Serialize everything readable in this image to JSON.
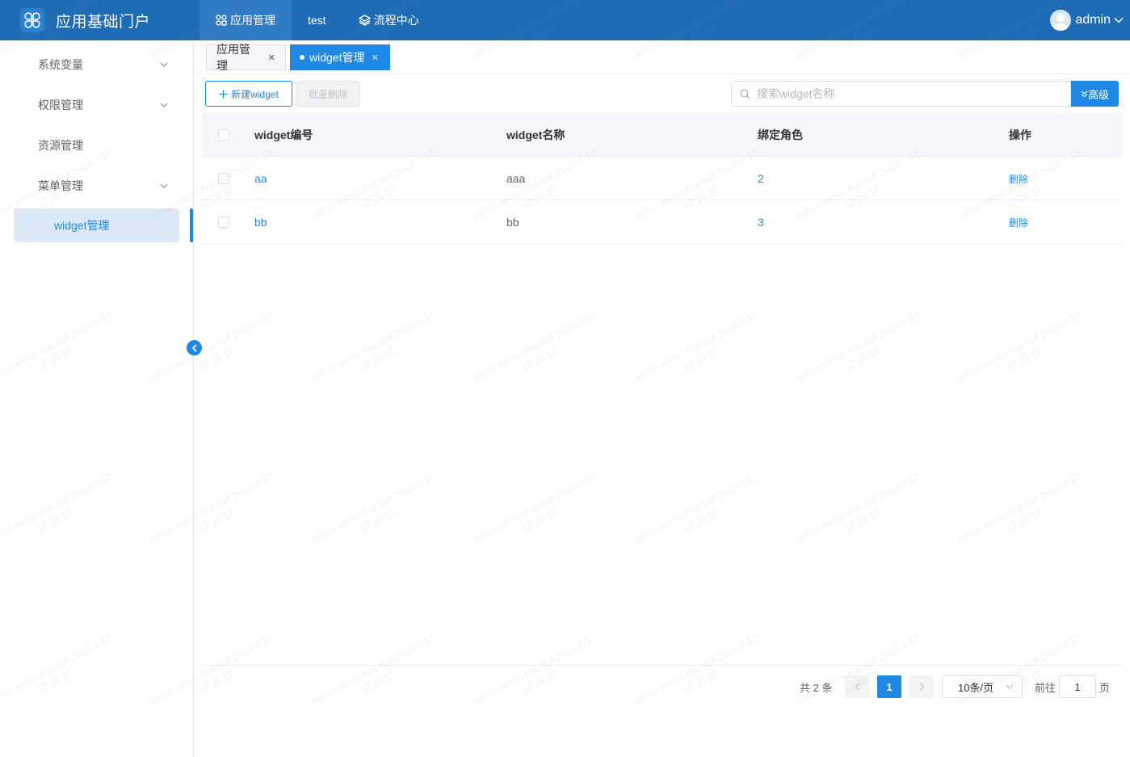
{
  "header": {
    "brand_title": "应用基础门户",
    "nav": [
      {
        "label": "应用管理",
        "icon": "grid-icon",
        "active": true
      },
      {
        "label": "test",
        "icon": "",
        "active": false
      },
      {
        "label": "流程中心",
        "icon": "layers-icon",
        "active": false
      }
    ],
    "user_name": "admin"
  },
  "sidebar": {
    "items": [
      {
        "label": "系统变量",
        "has_children": true
      },
      {
        "label": "权限管理",
        "has_children": true
      },
      {
        "label": "资源管理",
        "has_children": false
      },
      {
        "label": "菜单管理",
        "has_children": true
      }
    ],
    "active_sub": "widget管理"
  },
  "tabs": [
    {
      "label": "应用管理",
      "active": false
    },
    {
      "label": "widget管理",
      "active": true
    }
  ],
  "toolbar": {
    "new_label": "新建widget",
    "batch_delete_label": "批量删除",
    "search_placeholder": "搜索widget名称",
    "advanced_label": "高级"
  },
  "table": {
    "columns": [
      "widget编号",
      "widget名称",
      "绑定角色",
      "操作"
    ],
    "rows": [
      {
        "id": "aa",
        "name": "aaa",
        "roles": "2",
        "action": "删除"
      },
      {
        "id": "bb",
        "name": "bb",
        "roles": "3",
        "action": "删除"
      }
    ]
  },
  "pagination": {
    "total_text": "共 2 条",
    "current_page": "1",
    "page_size": "10条/页",
    "goto_label": "前往",
    "goto_value": "1",
    "page_suffix": "页"
  },
  "watermark": {
    "line1": "admin admin null null 2023-4-13",
    "line2": "12:25:15"
  },
  "colors": {
    "header_bg": "#1f6cb6",
    "accent": "#1e88e5",
    "active_sub_bg": "#dce9f7"
  }
}
